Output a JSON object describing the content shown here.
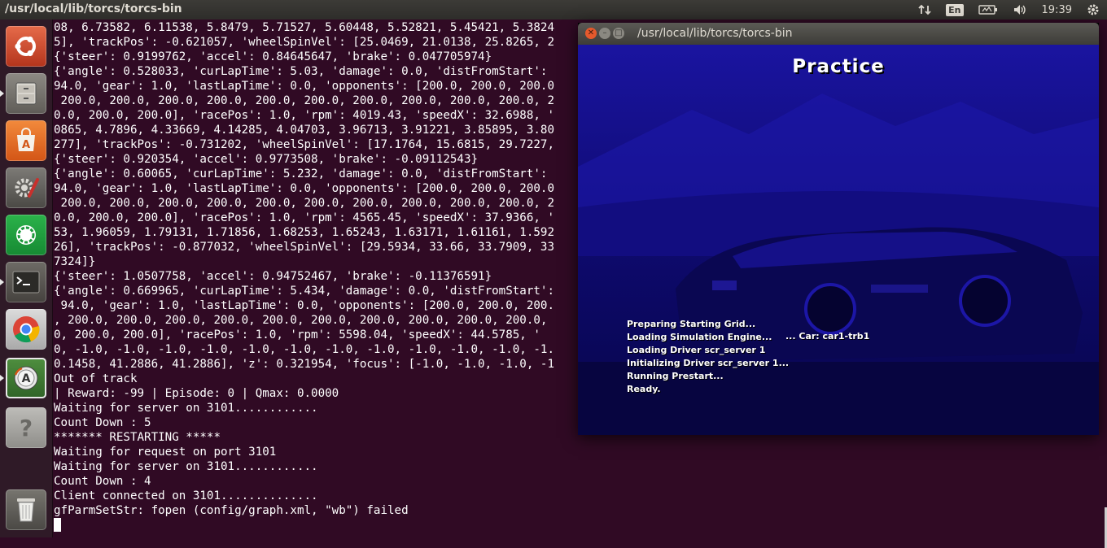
{
  "top_panel": {
    "app_title": "/usr/local/lib/torcs/torcs-bin",
    "keyboard_layout": "En",
    "clock": "19:39"
  },
  "launcher": {
    "items": [
      {
        "name": "Ubuntu Dash",
        "icon": "ubuntu-logo-icon"
      },
      {
        "name": "Files",
        "icon": "file-cabinet-icon"
      },
      {
        "name": "Ubuntu Software Center",
        "icon": "shopping-bag-icon"
      },
      {
        "name": "System Settings",
        "icon": "wrench-gear-icon"
      },
      {
        "name": "Application",
        "icon": "green-ring-icon"
      },
      {
        "name": "Terminal",
        "icon": "terminal-icon"
      },
      {
        "name": "Chromium",
        "icon": "chromium-icon"
      },
      {
        "name": "Software Updater",
        "icon": "updater-icon"
      },
      {
        "name": "Help",
        "icon": "question-icon"
      },
      {
        "name": "Trash",
        "icon": "trash-icon"
      }
    ]
  },
  "terminal": {
    "lines": [
      "08, 6.73582, 6.11538, 5.8479, 5.71527, 5.60448, 5.52821, 5.45421, 5.3824",
      "5], 'trackPos': -0.621057, 'wheelSpinVel': [25.0469, 21.0138, 25.8265, 2",
      "{'steer': 0.9199762, 'accel': 0.84645647, 'brake': 0.047705974}",
      "{'angle': 0.528033, 'curLapTime': 5.03, 'damage': 0.0, 'distFromStart':",
      "94.0, 'gear': 1.0, 'lastLapTime': 0.0, 'opponents': [200.0, 200.0, 200.0",
      " 200.0, 200.0, 200.0, 200.0, 200.0, 200.0, 200.0, 200.0, 200.0, 200.0, 2",
      "0.0, 200.0, 200.0], 'racePos': 1.0, 'rpm': 4019.43, 'speedX': 32.6988, '",
      "0865, 4.7896, 4.33669, 4.14285, 4.04703, 3.96713, 3.91221, 3.85895, 3.80",
      "277], 'trackPos': -0.731202, 'wheelSpinVel': [17.1764, 15.6815, 29.7227,",
      "{'steer': 0.920354, 'accel': 0.9773508, 'brake': -0.09112543}",
      "{'angle': 0.60065, 'curLapTime': 5.232, 'damage': 0.0, 'distFromStart':",
      "94.0, 'gear': 1.0, 'lastLapTime': 0.0, 'opponents': [200.0, 200.0, 200.0",
      " 200.0, 200.0, 200.0, 200.0, 200.0, 200.0, 200.0, 200.0, 200.0, 200.0, 2",
      "0.0, 200.0, 200.0], 'racePos': 1.0, 'rpm': 4565.45, 'speedX': 37.9366, '",
      "53, 1.96059, 1.79131, 1.71856, 1.68253, 1.65243, 1.63171, 1.61161, 1.592",
      "26], 'trackPos': -0.877032, 'wheelSpinVel': [29.5934, 33.66, 33.7909, 33",
      "7324]}",
      "{'steer': 1.0507758, 'accel': 0.94752467, 'brake': -0.11376591}",
      "{'angle': 0.669965, 'curLapTime': 5.434, 'damage': 0.0, 'distFromStart':",
      " 94.0, 'gear': 1.0, 'lastLapTime': 0.0, 'opponents': [200.0, 200.0, 200.",
      ", 200.0, 200.0, 200.0, 200.0, 200.0, 200.0, 200.0, 200.0, 200.0, 200.0,",
      "0, 200.0, 200.0], 'racePos': 1.0, 'rpm': 5598.04, 'speedX': 44.5785, '",
      "0, -1.0, -1.0, -1.0, -1.0, -1.0, -1.0, -1.0, -1.0, -1.0, -1.0, -1.0, -1.",
      "0.1458, 41.2886, 41.2886], 'z': 0.321954, 'focus': [-1.0, -1.0, -1.0, -1",
      "Out of track",
      "| Reward: -99 | Episode: 0 | Qmax: 0.0000",
      "Waiting for server on 3101............",
      "Count Down : 5",
      "******* RESTARTING *****",
      "Waiting for request on port 3101",
      "Waiting for server on 3101............",
      "Count Down : 4",
      "Client connected on 3101..............",
      "gfParmSetStr: fopen (config/graph.xml, \"wb\") failed"
    ]
  },
  "torcs_window": {
    "title": "/usr/local/lib/torcs/torcs-bin",
    "screen_title": "Practice",
    "loading_lines": [
      "Preparing Starting Grid...",
      "Loading Simulation Engine...",
      "Loading Driver scr_server 1",
      "Initializing Driver scr_server 1...",
      "Running Prestart...",
      "Ready."
    ],
    "car_info": "... Car: car1-trb1"
  }
}
